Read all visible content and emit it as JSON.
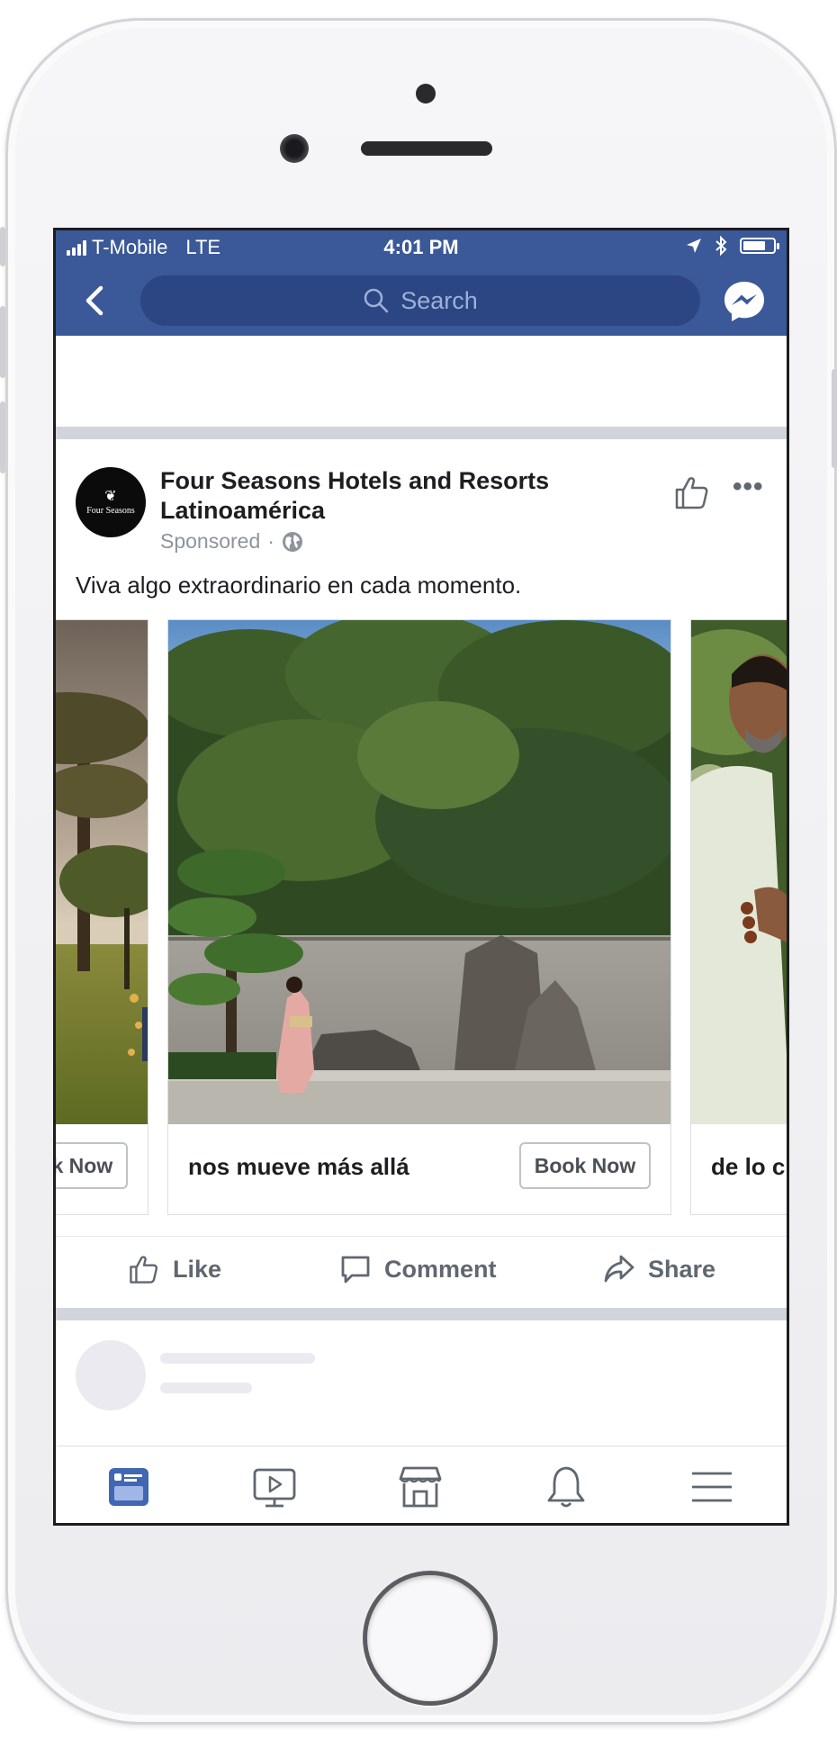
{
  "status_bar": {
    "carrier": "T-Mobile",
    "network": "LTE",
    "time": "4:01 PM",
    "signal_bars": 4,
    "battery_level": 0.7
  },
  "nav": {
    "search_placeholder": "Search",
    "back_icon": "chevron-left-icon",
    "messenger_icon": "messenger-icon"
  },
  "post": {
    "page_name": "Four Seasons Hotels and Resorts Latinoamérica",
    "avatar_text": "Four Seasons",
    "sponsored_label": "Sponsored",
    "separator": "·",
    "text": "Viva algo extraordinario en cada momento.",
    "more_label": "•••"
  },
  "carousel": {
    "cards": [
      {
        "title": "",
        "cta": "Book Now"
      },
      {
        "title": "nos mueve más allá",
        "cta": "Book Now"
      },
      {
        "title": "de lo c",
        "cta": ""
      }
    ]
  },
  "actions": {
    "like": "Like",
    "comment": "Comment",
    "share": "Share"
  },
  "tabbar": {
    "tabs": [
      "news-feed-icon",
      "watch-icon",
      "marketplace-icon",
      "notifications-icon",
      "menu-icon"
    ],
    "active_color": "#4267b2",
    "inactive_color": "#606770"
  },
  "colors": {
    "facebook_blue": "#3b5998",
    "search_bg": "#2b4683"
  }
}
